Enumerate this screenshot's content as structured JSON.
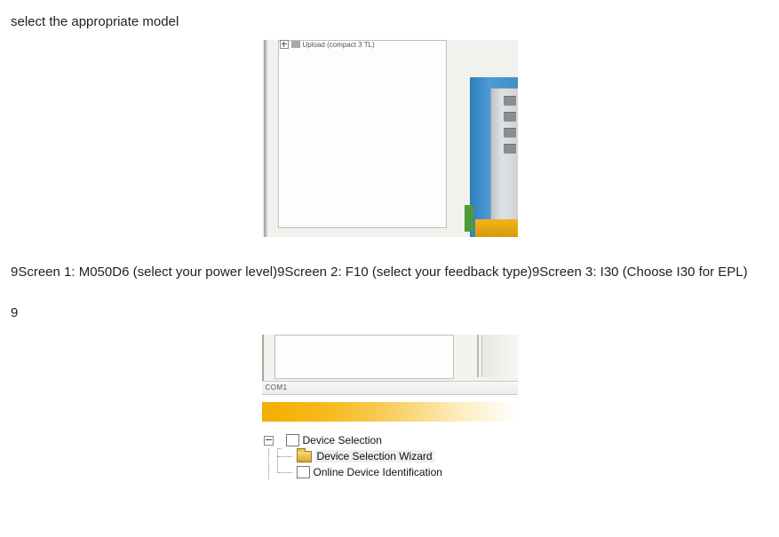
{
  "heading": "select the appropriate model",
  "figure1": {
    "pane_caption": "Upload (compact 3 TL)"
  },
  "screens_para": "9Screen 1: M050D6 (select your power level)9Screen 2: F10 (select your feedback type)9Screen 3: I30 (Choose I30 for EPL)",
  "nine": "9",
  "figure2": {
    "com_label": "COM1",
    "tree": {
      "root": "Device Selection",
      "child1": "Device Selection Wizard",
      "child2": "Online Device Identification"
    }
  }
}
